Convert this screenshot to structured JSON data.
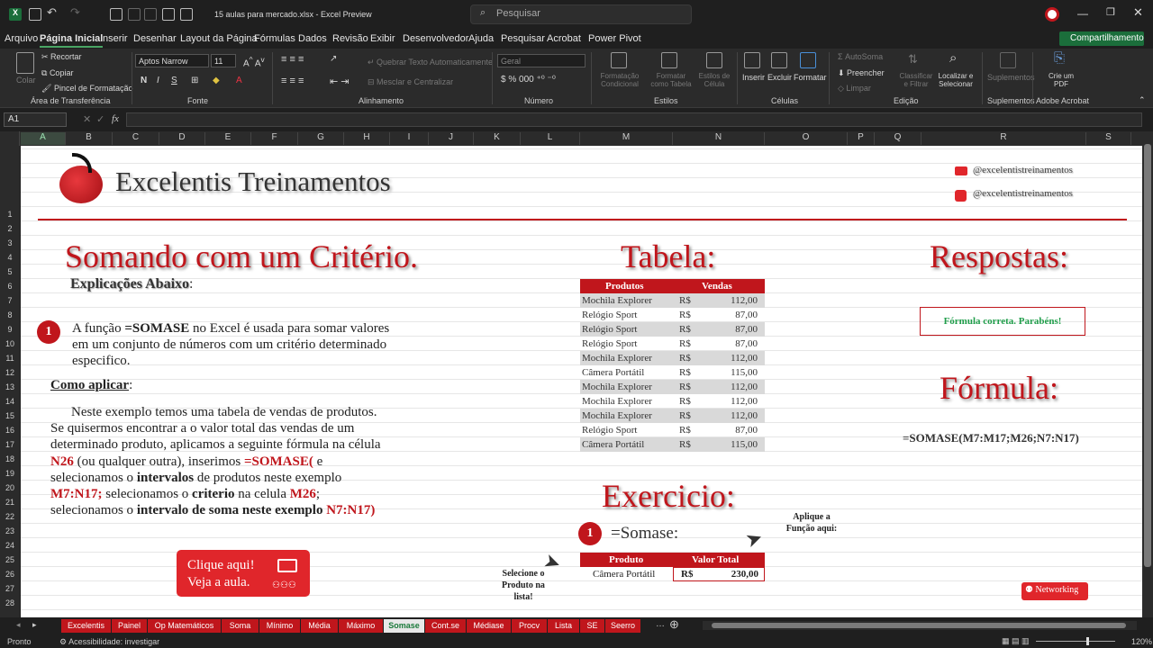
{
  "titlebar": {
    "file_title": "15 aulas para mercado.xlsx - Excel Preview",
    "search_placeholder": "Pesquisar"
  },
  "menu": {
    "items": [
      "Arquivo",
      "Página Inicial",
      "Inserir",
      "Desenhar",
      "Layout da Página",
      "Fórmulas",
      "Dados",
      "Revisão",
      "Exibir",
      "Desenvolvedor",
      "Ajuda",
      "Pesquisar",
      "Acrobat",
      "Power Pivot"
    ],
    "active": "Página Inicial",
    "share_label": "Compartilhamento"
  },
  "ribbon": {
    "clipboard": {
      "paste": "Colar",
      "cut": "Recortar",
      "copy": "Copiar",
      "format_painter": "Pincel de Formatação",
      "group": "Área de Transferência"
    },
    "font": {
      "name": "Aptos Narrow",
      "size": "11",
      "group": "Fonte"
    },
    "alignment": {
      "wrap": "Quebrar Texto Automaticamente",
      "merge": "Mesclar e Centralizar",
      "group": "Alinhamento"
    },
    "number": {
      "format": "Geral",
      "group": "Número"
    },
    "styles": {
      "conditional": "Formatação Condicional",
      "as_table": "Formatar como Tabela",
      "cell_styles": "Estilos de Célula",
      "group": "Estilos"
    },
    "cells": {
      "insert": "Inserir",
      "delete": "Excluir",
      "format": "Formatar",
      "group": "Células"
    },
    "editing": {
      "autosum": "AutoSoma",
      "fill": "Preencher",
      "clear": "Limpar",
      "sort": "Classificar e Filtrar",
      "find": "Localizar e Selecionar",
      "group": "Edição"
    },
    "addins": {
      "label": "Suplementos",
      "group": "Suplementos"
    },
    "acrobat": {
      "label": "Crie um PDF",
      "group": "Adobe Acrobat"
    }
  },
  "formula_bar": {
    "name_box": "A1",
    "fx": "fx",
    "value": ""
  },
  "columns": [
    "A",
    "B",
    "C",
    "D",
    "E",
    "F",
    "G",
    "H",
    "I",
    "J",
    "K",
    "L",
    "M",
    "N",
    "O",
    "P",
    "Q",
    "R",
    "S"
  ],
  "rows": [
    "1",
    "2",
    "3",
    "4",
    "5",
    "6",
    "7",
    "8",
    "9",
    "10",
    "11",
    "12",
    "13",
    "14",
    "15",
    "16",
    "17",
    "18",
    "19",
    "20",
    "21",
    "22",
    "23",
    "24",
    "25",
    "26",
    "27",
    "28"
  ],
  "header": {
    "brand": "Excelentis Treinamentos",
    "youtube": "@excelentistreinamentos",
    "instagram": "@excelentistreinamentos"
  },
  "left": {
    "title": "Somando com um Critério.",
    "subtitle": "Explicações Abaixo",
    "badge": "1",
    "p1_a": "A função ",
    "p1_b": "=SOMASE",
    "p1_c": " no Excel é usada para somar valores",
    "p1_line2": "em um conjunto de números com um critério determinado",
    "p1_line3": "especifico.",
    "how_title": "Como aplicar",
    "l1": "Neste exemplo temos uma tabela de vendas de produtos.",
    "l2": "Se quisermos encontrar a o valor total das vendas de um",
    "l3": "determinado produto, aplicamos a seguinte fórmula na célula",
    "l4a": "N26",
    "l4b": " (ou qualquer outra), inserimos ",
    "l4c": "=SOMASE(",
    "l4d": " e",
    "l5a": "selecionamos o ",
    "l5b": "intervalos",
    "l5c": " de produtos neste exemplo",
    "l6a": "M7:N17;",
    "l6b": " selecionamos o ",
    "l6c": "criterio",
    "l6d": " na celula ",
    "l6e": "M26",
    "l7a": "selecionamos o ",
    "l7b": "intervalo de soma neste exemplo ",
    "l7c": "N7:N17)",
    "cta_line1": "Clique aqui!",
    "cta_line2": "Veja a aula."
  },
  "table": {
    "title": "Tabela:",
    "headers": [
      "Produtos",
      "Vendas"
    ],
    "currency": "R$",
    "rows": [
      [
        "Mochila Explorer",
        "112,00"
      ],
      [
        "Relógio Sport",
        "87,00"
      ],
      [
        "Relógio Sport",
        "87,00"
      ],
      [
        "Relógio Sport",
        "87,00"
      ],
      [
        "Mochila Explorer",
        "112,00"
      ],
      [
        "Câmera Portátil",
        "115,00"
      ],
      [
        "Mochila Explorer",
        "112,00"
      ],
      [
        "Mochila Explorer",
        "112,00"
      ],
      [
        "Mochila Explorer",
        "112,00"
      ],
      [
        "Relógio Sport",
        "87,00"
      ],
      [
        "Câmera Portátil",
        "115,00"
      ]
    ]
  },
  "exercise": {
    "title": "Exercicio:",
    "badge": "1",
    "formula_hint": "=Somase:",
    "apply_hint": "Aplique a Função aqui:",
    "select_hint": "Selecione o Produto na lista!",
    "headers": [
      "Produto",
      "Valor Total"
    ],
    "product": "Câmera Portátil",
    "currency": "R$",
    "total": "230,00"
  },
  "answers": {
    "title": "Respostas:",
    "feedback": "Fórmula correta. Parabéns!",
    "formula_title": "Fórmula:",
    "formula": "=SOMASE(M7:M17;M26;N7:N17)",
    "networking": "Networking"
  },
  "tabs": [
    "Excelentis",
    "Painel",
    "Op Matemáticos",
    "Soma",
    "Mínimo",
    "Média",
    "Máximo",
    "Somase",
    "Cont.se",
    "Médiase",
    "Procv",
    "Lista",
    "SE",
    "Seerro"
  ],
  "active_tab": "Somase",
  "status": {
    "ready": "Pronto",
    "accessibility": "Acessibilidade: investigar",
    "zoom": "120%"
  },
  "colors": {
    "accent": "#c0161c",
    "excel_green": "#1b6e3b"
  }
}
